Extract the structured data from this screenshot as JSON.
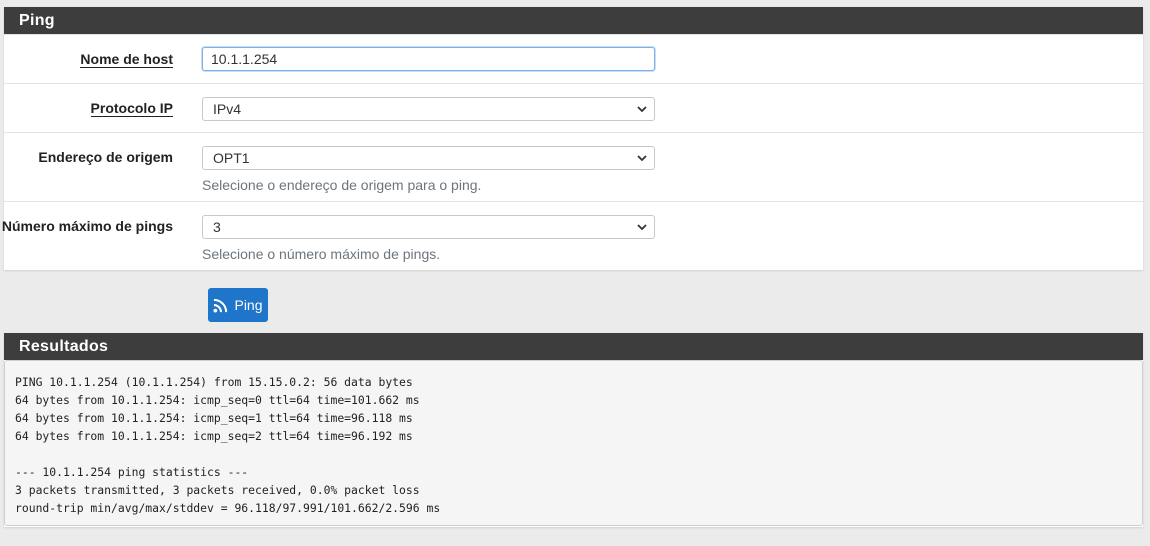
{
  "ping_panel": {
    "title": "Ping",
    "hostname": {
      "label": "Nome de host",
      "value": "10.1.1.254"
    },
    "ip_protocol": {
      "label": "Protocolo IP",
      "selected": "IPv4"
    },
    "source_address": {
      "label": "Endereço de origem",
      "selected": "OPT1",
      "help": "Selecione o endereço de origem para o ping."
    },
    "max_pings": {
      "label": "Número máximo de pings",
      "selected": "3",
      "help": "Selecione o número máximo de pings."
    }
  },
  "ping_button": {
    "label": "Ping",
    "icon": "rss-icon",
    "color": "#1e75c9"
  },
  "results_panel": {
    "title": "Resultados",
    "lines": [
      "PING 10.1.1.254 (10.1.1.254) from 15.15.0.2: 56 data bytes",
      "64 bytes from 10.1.1.254: icmp_seq=0 ttl=64 time=101.662 ms",
      "64 bytes from 10.1.1.254: icmp_seq=1 ttl=64 time=96.118 ms",
      "64 bytes from 10.1.1.254: icmp_seq=2 ttl=64 time=96.192 ms",
      "",
      "--- 10.1.1.254 ping statistics ---",
      "3 packets transmitted, 3 packets received, 0.0% packet loss",
      "round-trip min/avg/max/stddev = 96.118/97.991/101.662/2.596 ms"
    ]
  },
  "colors": {
    "heading_bg": "#3d3d3d",
    "page_bg": "#ebebeb"
  }
}
